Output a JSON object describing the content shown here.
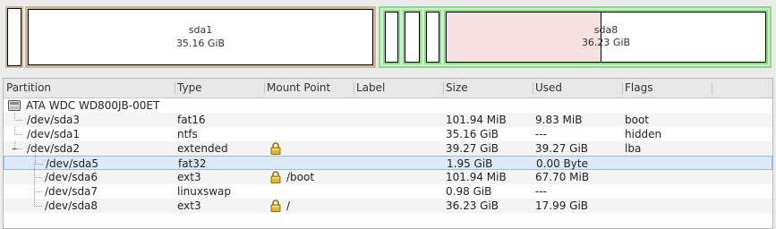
{
  "disk_map": {
    "sda1": {
      "name": "sda1",
      "size": "35.16 GiB"
    },
    "sda8": {
      "name": "sda8",
      "size": "36.23 GiB"
    },
    "colors": {
      "ntfs": "#c9b99a",
      "extended": "#8ed88c",
      "sda8_used": "#f5e2e0",
      "outline": "#000000"
    }
  },
  "columns": {
    "partition": "Partition",
    "type": "Type",
    "mount_point": "Mount Point",
    "label": "Label",
    "size": "Size",
    "used": "Used",
    "flags": "Flags"
  },
  "device": {
    "name": "ATA WDC WD800JB-00ET"
  },
  "partitions": [
    {
      "partition": "/dev/sda3",
      "type": "fat16",
      "mount": "",
      "label": "",
      "size": "101.94 MiB",
      "used": "9.83 MiB",
      "flags": "boot"
    },
    {
      "partition": "/dev/sda1",
      "type": "ntfs",
      "mount": "",
      "label": "",
      "size": "35.16 GiB",
      "used": "---",
      "flags": "hidden"
    },
    {
      "expander": "–",
      "partition": "/dev/sda2",
      "type": "extended",
      "mount": "",
      "label": "",
      "size": "39.27 GiB",
      "used": "39.27 GiB",
      "flags": "lba"
    },
    {
      "partition": "/dev/sda5",
      "type": "fat32",
      "mount": "",
      "label": "",
      "size": "1.95 GiB",
      "used": "0.00 Byte",
      "flags": ""
    },
    {
      "partition": "/dev/sda6",
      "type": "ext3",
      "mount": "/boot",
      "label": "",
      "size": "101.94 MiB",
      "used": "67.70 MiB",
      "flags": ""
    },
    {
      "partition": "/dev/sda7",
      "type": "linuxswap",
      "mount": "",
      "label": "",
      "size": "0.98 GiB",
      "used": "---",
      "flags": ""
    },
    {
      "partition": "/dev/sda8",
      "type": "ext3",
      "mount": "/",
      "label": "",
      "size": "36.23 GiB",
      "used": "17.99 GiB",
      "flags": ""
    }
  ]
}
